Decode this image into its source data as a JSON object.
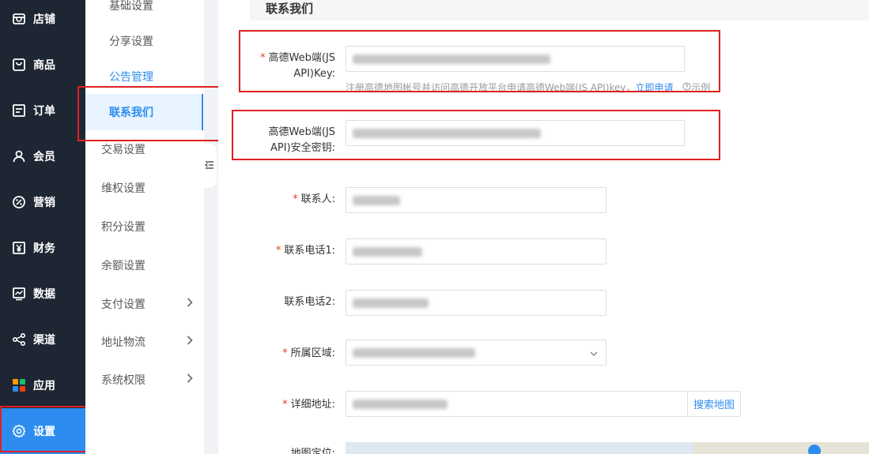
{
  "nav": [
    {
      "label": "店铺",
      "icon": "store-icon"
    },
    {
      "label": "商品",
      "icon": "bag-icon"
    },
    {
      "label": "订单",
      "icon": "order-icon"
    },
    {
      "label": "会员",
      "icon": "user-icon"
    },
    {
      "label": "营销",
      "icon": "promotion-icon"
    },
    {
      "label": "财务",
      "icon": "yen-icon"
    },
    {
      "label": "数据",
      "icon": "chart-icon"
    },
    {
      "label": "渠道",
      "icon": "share-icon"
    },
    {
      "label": "应用",
      "icon": "apps-icon"
    },
    {
      "label": "设置",
      "icon": "gear-icon"
    }
  ],
  "subnav": [
    {
      "label": "基础设置"
    },
    {
      "label": "分享设置"
    },
    {
      "label": "公告管理"
    },
    {
      "label": "联系我们"
    },
    {
      "label": "交易设置"
    },
    {
      "label": "维权设置"
    },
    {
      "label": "积分设置"
    },
    {
      "label": "余额设置"
    },
    {
      "label": "支付设置"
    },
    {
      "label": "地址物流"
    },
    {
      "label": "系统权限"
    }
  ],
  "page": {
    "title": "联系我们"
  },
  "form": {
    "amap_key_label_1": "高德Web端(JS",
    "amap_key_label_2": "API)Key:",
    "amap_hint": "注册高德地图帐号并访问高德开放平台申请高德Web端(JS API)key，",
    "amap_apply_link": "立即申请",
    "amap_example": "示例",
    "amap_secret_label_1": "高德Web端(JS",
    "amap_secret_label_2": "API)安全密钥:",
    "contact_label": "联系人:",
    "phone1_label": "联系电话1:",
    "phone2_label": "联系电话2:",
    "region_label": "所属区域:",
    "address_label": "详细地址:",
    "search_map": "搜索地图",
    "map_label": "地图定位:"
  },
  "colors": {
    "accent": "#2d8cf0",
    "sidebar": "#1f2633",
    "highlight_box": "#e02020"
  }
}
